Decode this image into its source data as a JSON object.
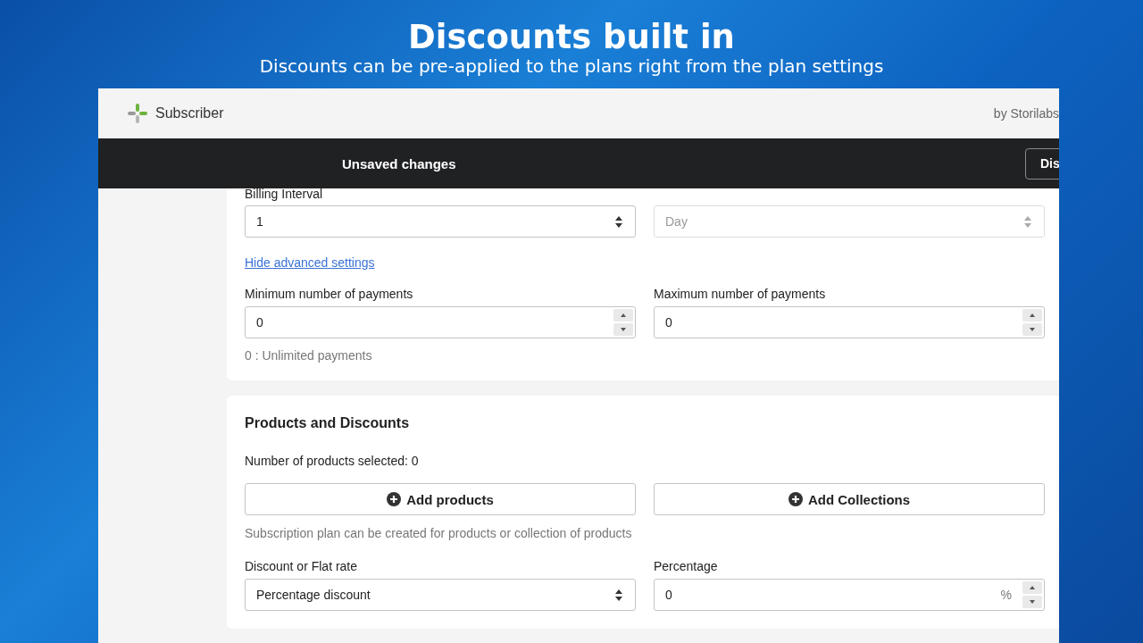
{
  "banner": {
    "title": "Discounts built in",
    "subtitle": "Discounts can be pre-applied to the plans right from the plan settings"
  },
  "app": {
    "name": "Subscriber",
    "byline": "by Storilabs"
  },
  "save_bar": {
    "message": "Unsaved changes",
    "button": "Dis"
  },
  "billing": {
    "label": "Billing Interval",
    "fields": [
      {
        "kind": "select",
        "value": "1",
        "disabled": false
      },
      {
        "kind": "select",
        "value": "Day",
        "disabled": true
      }
    ],
    "link": "Hide advanced settings",
    "payment_fields": [
      {
        "label": "Minimum number of payments",
        "kind": "number",
        "value": "0"
      },
      {
        "label": "Maximum number of payments",
        "kind": "number",
        "value": "0"
      }
    ],
    "help": "0 : Unlimited payments"
  },
  "products": {
    "title": "Products and Discounts",
    "count": "Number of products selected: 0",
    "buttons": [
      "Add products",
      "Add Collections"
    ],
    "help": "Subscription plan can be created for products or collection of products",
    "fields": [
      {
        "label": "Discount or Flat rate",
        "kind": "select",
        "value": "Percentage discount",
        "disabled": false
      },
      {
        "label": "Percentage",
        "kind": "number",
        "value": "0",
        "suffix": "%"
      }
    ]
  }
}
